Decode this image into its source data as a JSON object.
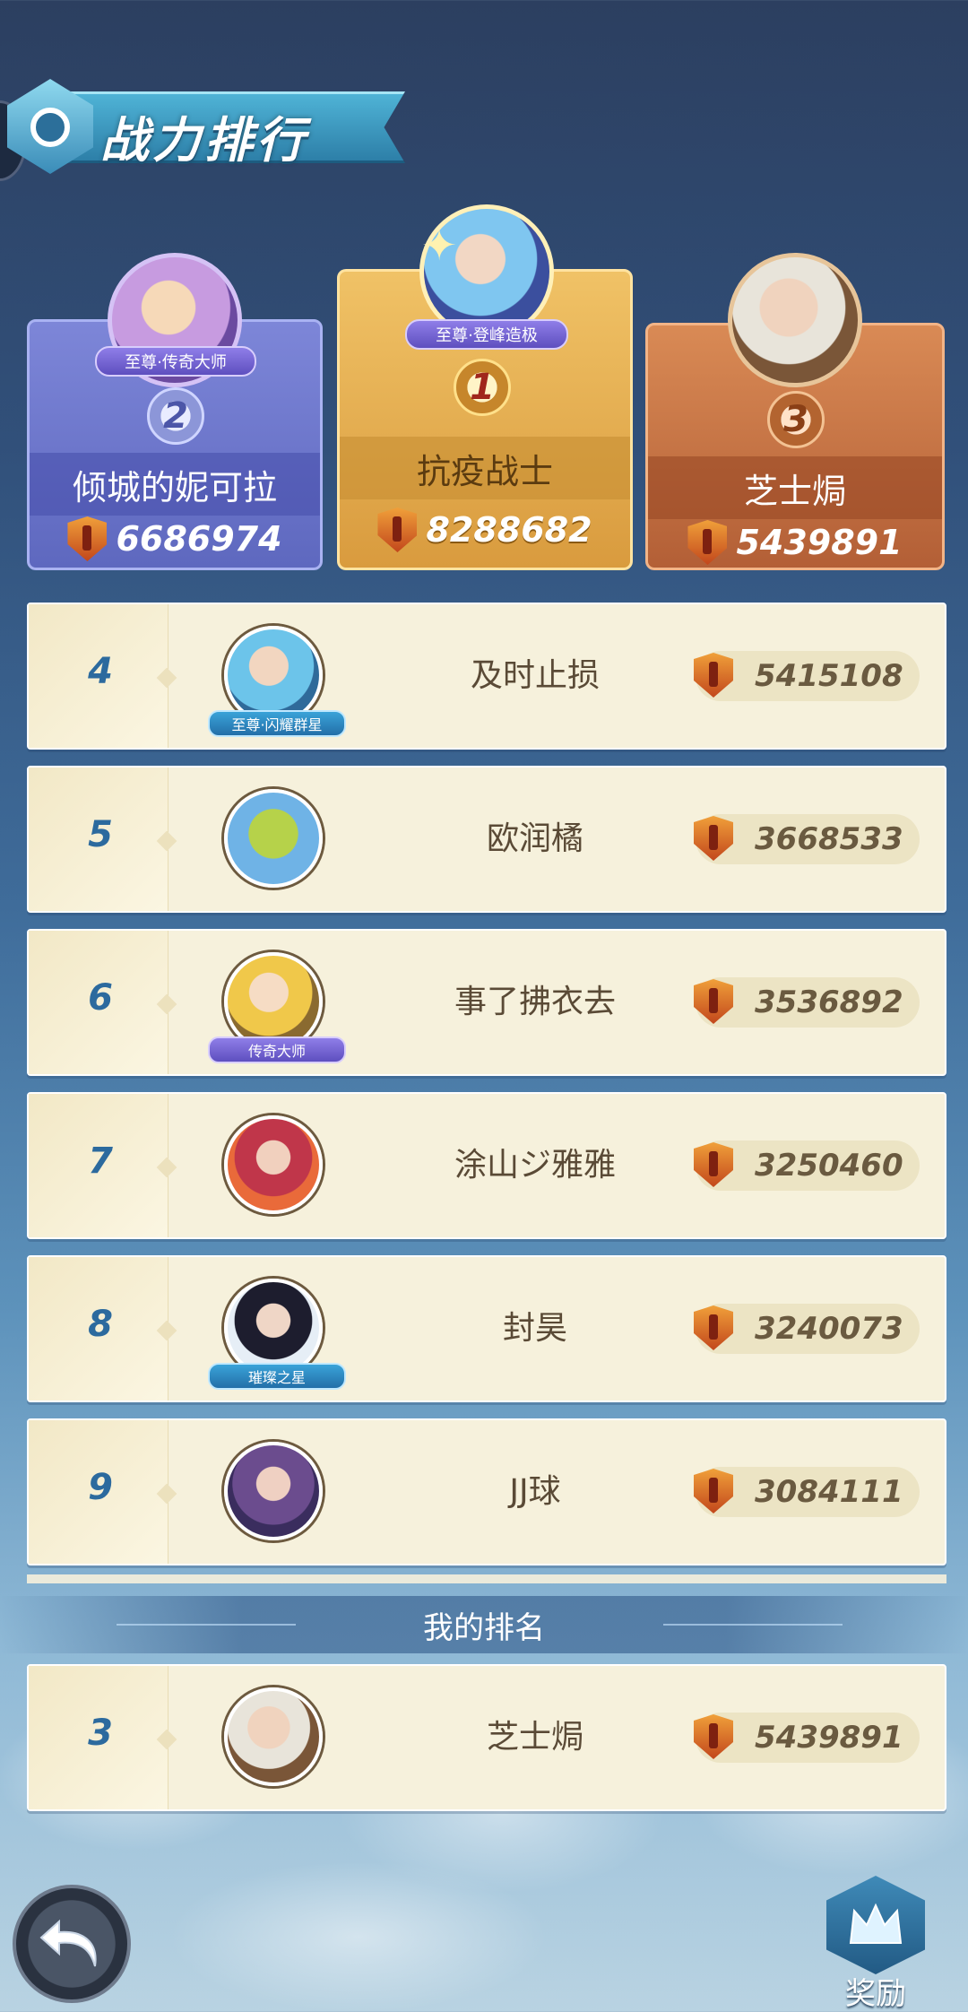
{
  "header": {
    "title": "战力排行"
  },
  "top3": [
    {
      "rank": "2",
      "name": "倾城的妮可拉",
      "power": "6686974",
      "title_tag": "至尊·传奇大师"
    },
    {
      "rank": "1",
      "name": "抗疫战士",
      "power": "8288682",
      "title_tag": "至尊·登峰造极"
    },
    {
      "rank": "3",
      "name": "芝士焗",
      "power": "5439891",
      "title_tag": ""
    }
  ],
  "list": [
    {
      "rank": "4",
      "name": "及时止损",
      "power": "5415108",
      "badge": "至尊·闪耀群星"
    },
    {
      "rank": "5",
      "name": "欧润橘",
      "power": "3668533",
      "badge": ""
    },
    {
      "rank": "6",
      "name": "事了拂衣去",
      "power": "3536892",
      "badge": "传奇大师"
    },
    {
      "rank": "7",
      "name": "涂山ジ雅雅",
      "power": "3250460",
      "badge": ""
    },
    {
      "rank": "8",
      "name": "封昊",
      "power": "3240073",
      "badge": "璀璨之星"
    },
    {
      "rank": "9",
      "name": "JJ球",
      "power": "3084111",
      "badge": ""
    }
  ],
  "my_rank": {
    "header": "我的排名",
    "rank": "3",
    "name": "芝士焗",
    "power": "5439891"
  },
  "buttons": {
    "reward_label": "奖励"
  },
  "icons": {
    "power": "shield-sword-icon",
    "back": "back-arrow-icon",
    "reward": "crown-icon",
    "title": "shield-emblem-icon"
  },
  "colors": {
    "rank_gold": "#f0c266",
    "rank_silver": "#7d86d8",
    "rank_bronze": "#d98a55",
    "row_bg": "#f6f1dc",
    "rank_text": "#2c6a9e"
  }
}
